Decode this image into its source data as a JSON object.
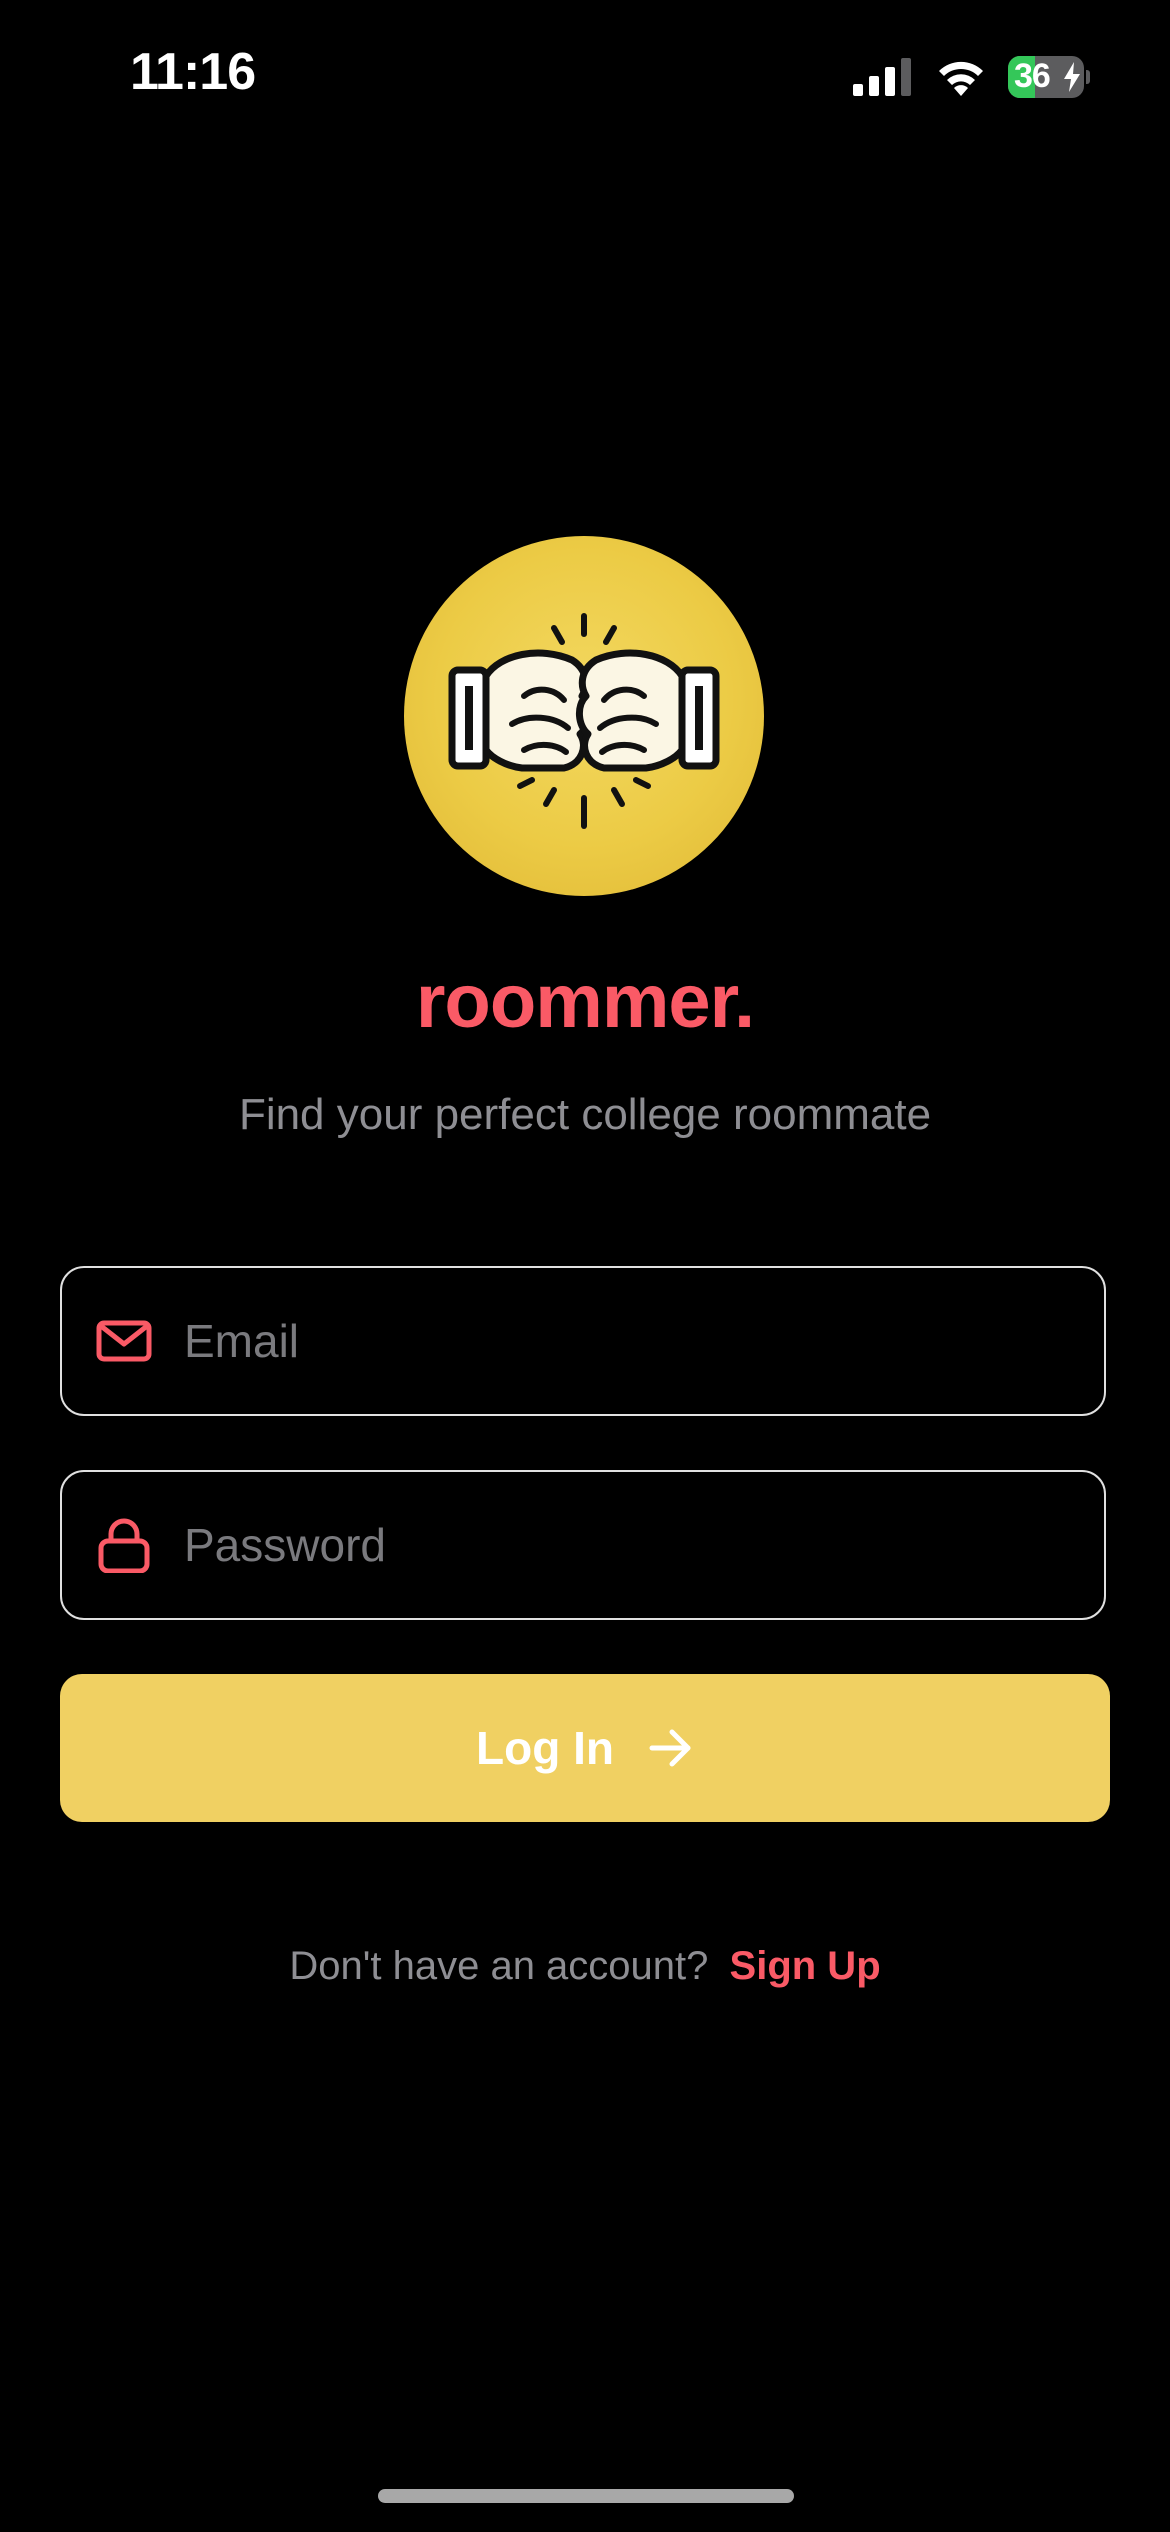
{
  "status_bar": {
    "time": "11:16",
    "battery_level": "36",
    "battery_fraction": 0.36,
    "icons": [
      "cellular-signal-icon",
      "wifi-icon",
      "battery-charging-icon"
    ]
  },
  "app": {
    "name": "roommer.",
    "tagline": "Find your perfect college roommate",
    "logo": "fist-bump-logo"
  },
  "form": {
    "email_placeholder": "Email",
    "email_value": "",
    "password_placeholder": "Password",
    "password_value": "",
    "login_label": "Log In"
  },
  "signup": {
    "prompt": "Don't have an account?",
    "link_label": "Sign Up"
  },
  "colors": {
    "background": "#000000",
    "brand_accent": "#fa5a66",
    "button_yellow": "#f0d062",
    "logo_yellow": "#eccb45",
    "muted_text": "#8e8e93"
  }
}
